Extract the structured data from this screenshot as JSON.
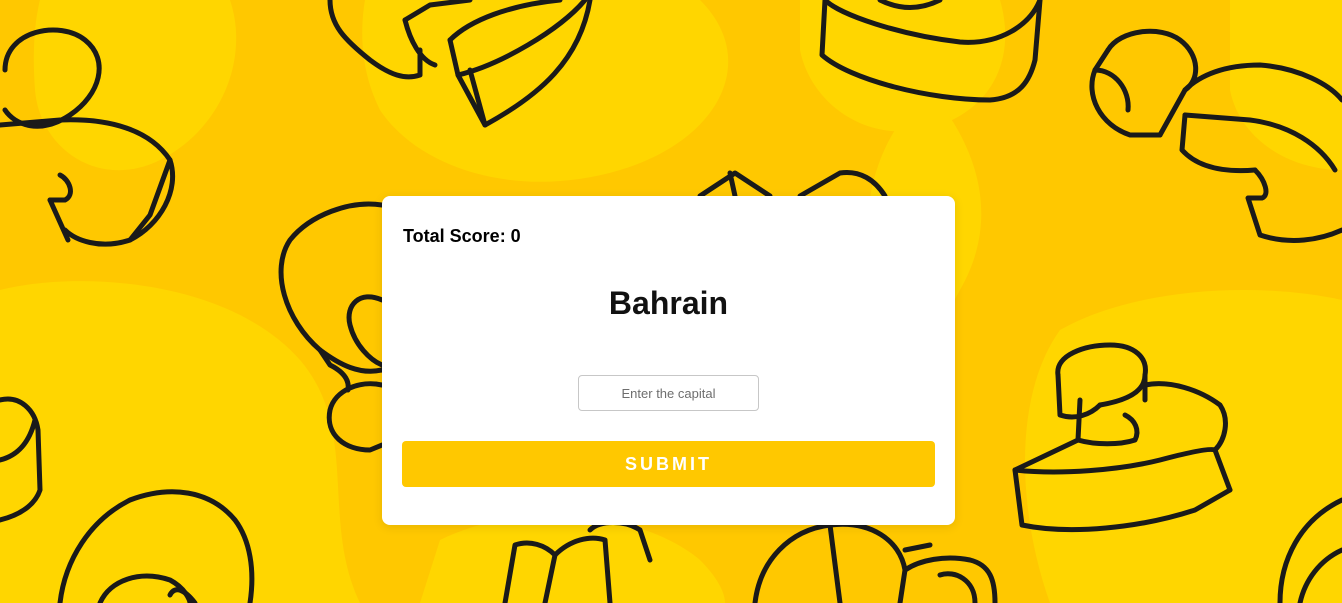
{
  "game": {
    "score_label": "Total Score: 0",
    "country": "Bahrain",
    "input_placeholder": "Enter the capital",
    "input_value": "",
    "submit_label": "SUBMIT"
  },
  "colors": {
    "background": "#ffc800",
    "background_blob": "#ffd600",
    "doodle_stroke": "#1a1a1a",
    "card": "#ffffff",
    "button": "#ffc800",
    "button_text": "#ffffff"
  }
}
